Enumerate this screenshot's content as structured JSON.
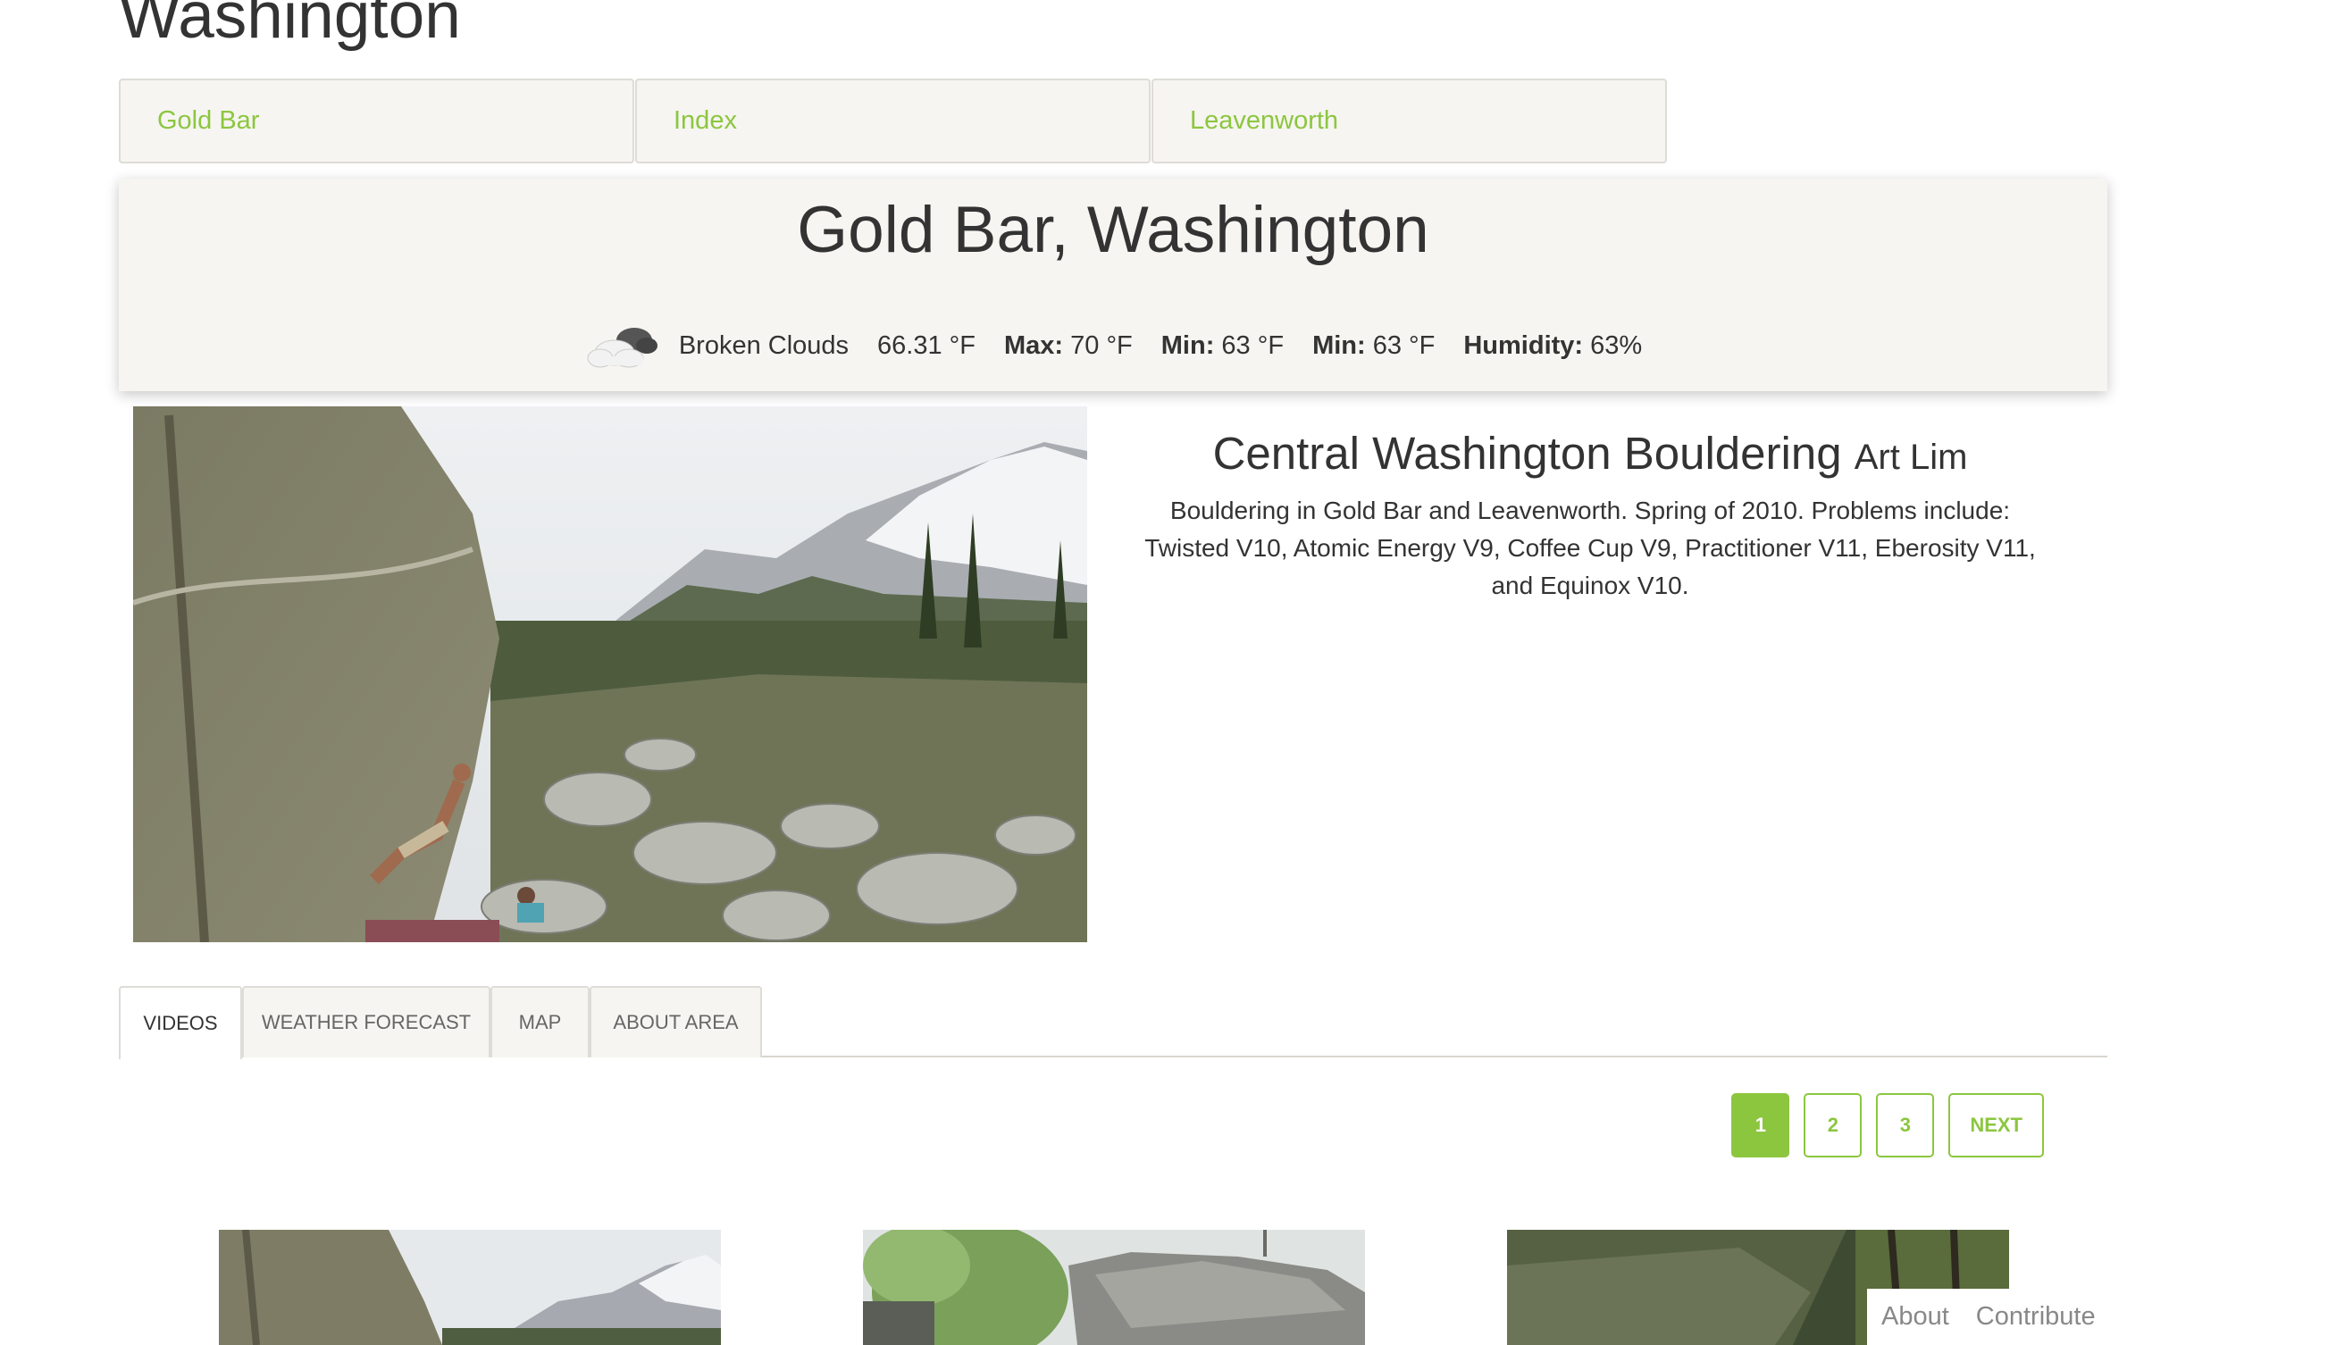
{
  "state": {
    "title": "Washington"
  },
  "area_tabs": [
    {
      "label": "Gold Bar"
    },
    {
      "label": "Index"
    },
    {
      "label": "Leavenworth"
    }
  ],
  "weather": {
    "location": "Gold Bar, Washington",
    "icon": "broken-clouds-icon",
    "condition": "Broken Clouds",
    "temp": "66.31 °F",
    "max_label": "Max:",
    "max_value": "70 °F",
    "min_label": "Min:",
    "min_value": "63 °F",
    "min2_label": "Min:",
    "min2_value": "63 °F",
    "humidity_label": "Humidity:",
    "humidity_value": "63%"
  },
  "video": {
    "title": "Central Washington Bouldering",
    "author": "Art Lim",
    "description": "Bouldering in Gold Bar and Leavenworth. Spring of 2010. Problems include: Twisted V10, Atomic Energy V9, Coffee Cup V9, Practitioner V11, Eberosity V11, and Equinox V10."
  },
  "section_tabs": [
    {
      "label": "VIDEOS",
      "active": true
    },
    {
      "label": "WEATHER FORECAST",
      "active": false
    },
    {
      "label": "MAP",
      "active": false
    },
    {
      "label": "ABOUT AREA",
      "active": false
    }
  ],
  "pagination": {
    "pages": [
      "1",
      "2",
      "3"
    ],
    "current": "1",
    "next_label": "NEXT"
  },
  "footer": {
    "about": "About",
    "contribute": "Contribute"
  },
  "colors": {
    "accent": "#8cc63f",
    "card_bg": "#f7f5f1",
    "text": "#333333"
  }
}
